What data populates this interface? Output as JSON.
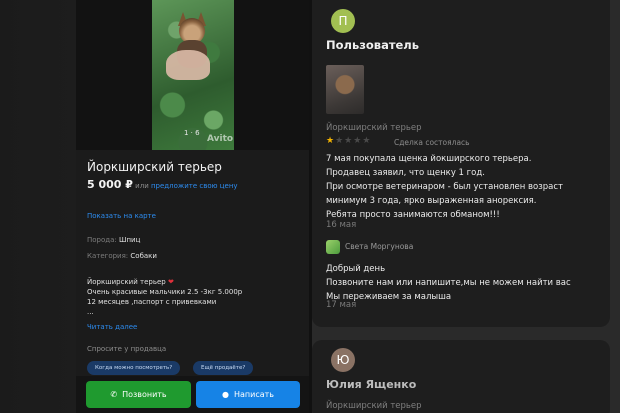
{
  "listing": {
    "photo_counter": "1 · 6",
    "watermark": "Avito",
    "title": "Йоркширский терьер",
    "price": "5 000 ₽",
    "price_or": "или",
    "offer_price": "предложите свою цену",
    "show_on_map": "Показать на карте",
    "breed_label": "Порода:",
    "breed_value": "Шпиц",
    "category_label": "Категория:",
    "category_value": "Собаки",
    "description_lines": [
      "Йоркширский терьер",
      "Очень красивые мальчики 2.5 -3кг 5.000р",
      "12 месяцев ,паспорт с привевками",
      "..."
    ],
    "heart": "❤",
    "read_more": "Читать далее",
    "ask_seller": "Спросите у продавца",
    "quick_questions": [
      "Когда можно посмотреть?",
      "Ещё продаёте?"
    ],
    "call_button": "Позвонить",
    "write_button": "Написать",
    "colors": {
      "call": "#1f9a2f",
      "write": "#1683e6",
      "link": "#2d8cf0"
    }
  },
  "reviews": {
    "first": {
      "avatar_letter": "П",
      "avatar_color": "#a2bf52",
      "name": "Пользователь",
      "item": "Йоркширский терьер",
      "rating": 1,
      "rating_max": 5,
      "star_filled": "★",
      "star_empty": "★",
      "deal_status": "Сделка состоялась",
      "text_lines": [
        "7 мая покупала щенка йокширского терьера.",
        "Продавец заявил, что щенку 1 год.",
        "При осмотре ветеринаром - был установлен возраст",
        "минимум 3 года, ярко выраженная анорексия.",
        "Ребята просто занимаются обманом!!!"
      ],
      "date": "16 мая",
      "reply": {
        "name": "Света Моргунова",
        "text_lines": [
          "Добрый день",
          "Позвоните нам или напишите,мы не можем найти вас",
          "Мы переживаем за малыша"
        ],
        "date": "17 мая"
      }
    },
    "second": {
      "avatar_letter": "Ю",
      "avatar_color": "#8a7264",
      "name": "Юлия Ященко",
      "item": "Йоркширский терьер"
    }
  }
}
